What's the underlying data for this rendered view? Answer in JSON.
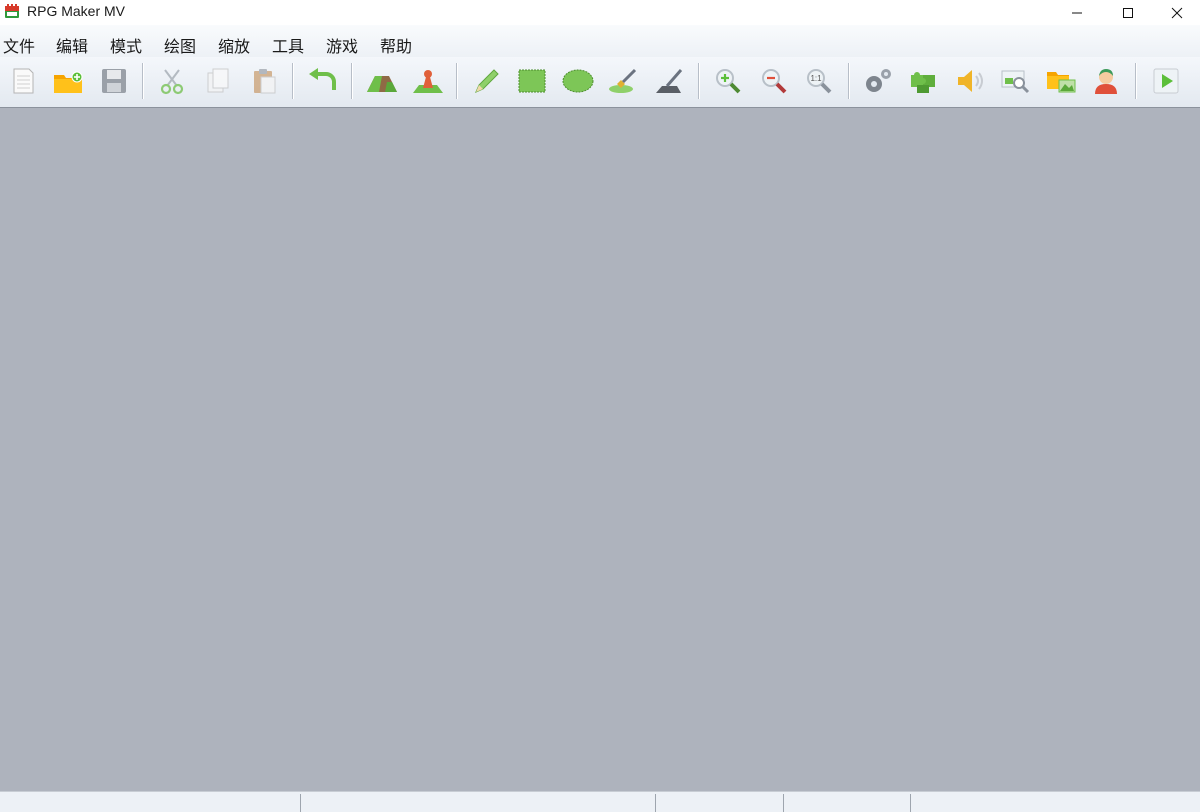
{
  "window": {
    "title": "RPG Maker MV"
  },
  "menubar": {
    "items": [
      {
        "label": "文件"
      },
      {
        "label": "编辑"
      },
      {
        "label": "模式"
      },
      {
        "label": "绘图"
      },
      {
        "label": "缩放"
      },
      {
        "label": "工具"
      },
      {
        "label": "游戏"
      },
      {
        "label": "帮助"
      }
    ]
  },
  "toolbar": {
    "buttons": [
      {
        "icon": "new-project-icon"
      },
      {
        "icon": "open-project-icon"
      },
      {
        "icon": "save-project-icon"
      },
      {
        "icon": "cut-icon"
      },
      {
        "icon": "copy-icon"
      },
      {
        "icon": "paste-icon"
      },
      {
        "icon": "undo-icon"
      },
      {
        "icon": "map-mode-icon"
      },
      {
        "icon": "event-mode-icon"
      },
      {
        "icon": "pencil-icon"
      },
      {
        "icon": "rectangle-icon"
      },
      {
        "icon": "ellipse-icon"
      },
      {
        "icon": "flood-fill-icon"
      },
      {
        "icon": "shadow-pen-icon"
      },
      {
        "icon": "zoom-in-icon"
      },
      {
        "icon": "zoom-out-icon"
      },
      {
        "icon": "zoom-actual-size-icon"
      },
      {
        "icon": "database-icon"
      },
      {
        "icon": "plugin-manager-icon"
      },
      {
        "icon": "sound-test-icon"
      },
      {
        "icon": "event-searcher-icon"
      },
      {
        "icon": "resource-manager-icon"
      },
      {
        "icon": "character-generator-icon"
      },
      {
        "icon": "playtest-icon"
      }
    ],
    "zoom_actual_label": "1:1"
  },
  "colors": {
    "workspace": "#aeb3bd",
    "toolbar_bg": "#e3e9f0",
    "folder": "#f5a800",
    "green": "#6fbf4a"
  }
}
